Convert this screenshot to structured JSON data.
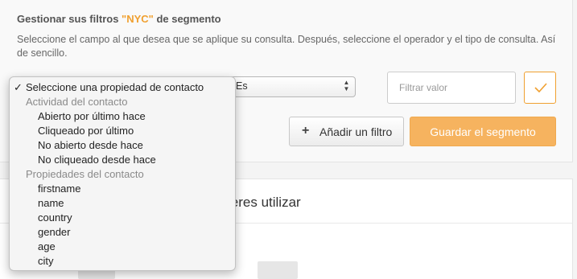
{
  "header": {
    "title_prefix": "Gestionar sus filtros ",
    "title_accent": "\"NYC\"",
    "title_suffix": " de segmento",
    "description": "Seleccione el campo al que desea que se aplique su consulta. Después, seleccione el operador y el tipo de consulta. Así de sencillo."
  },
  "filter": {
    "operator_value": "Es",
    "value_placeholder": "Filtrar valor"
  },
  "buttons": {
    "add_filter": "Añadir un filtro",
    "save_segment": "Guardar el segmento"
  },
  "bottom": {
    "heading_partial": "ieres utilizar"
  },
  "property_dropdown": {
    "selected_label": "Seleccione una propiedad de contacto",
    "checkmark": "✓",
    "groups": [
      {
        "label": "Actividad del contacto",
        "options": [
          "Abierto por último hace",
          "Cliqueado por último",
          "No abierto desde hace",
          "No cliqueado desde hace"
        ]
      },
      {
        "label": "Propiedades del contacto",
        "options": [
          "firstname",
          "name",
          "country",
          "gender",
          "age",
          "city"
        ]
      }
    ]
  },
  "colors": {
    "accent": "#f0a030",
    "save_button": "#f6b35f"
  }
}
